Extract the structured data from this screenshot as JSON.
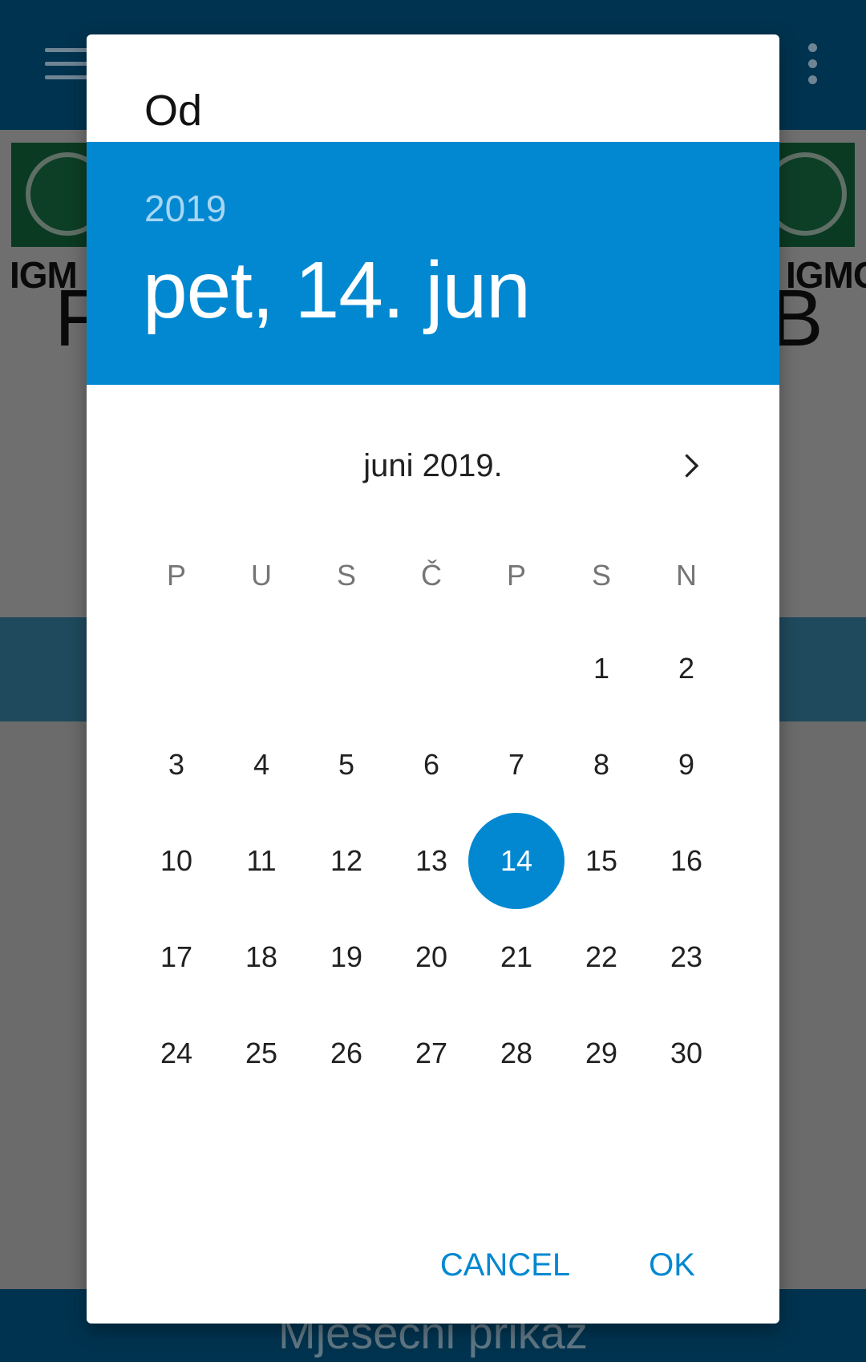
{
  "background": {
    "bottom_bar_text": "Mjesečni prikaz",
    "logo_text_left": "IGM",
    "logo_text_right": "IGMG",
    "big_letter_left": "F",
    "big_letter_right": "B"
  },
  "dialog": {
    "title": "Od",
    "header": {
      "year": "2019",
      "date": "pet, 14. jun"
    },
    "month_label": "juni 2019.",
    "weekdays": [
      "P",
      "U",
      "S",
      "Č",
      "P",
      "S",
      "N"
    ],
    "weeks": [
      [
        "",
        "",
        "",
        "",
        "",
        "1",
        "2"
      ],
      [
        "3",
        "4",
        "5",
        "6",
        "7",
        "8",
        "9"
      ],
      [
        "10",
        "11",
        "12",
        "13",
        "14",
        "15",
        "16"
      ],
      [
        "17",
        "18",
        "19",
        "20",
        "21",
        "22",
        "23"
      ],
      [
        "24",
        "25",
        "26",
        "27",
        "28",
        "29",
        "30"
      ]
    ],
    "selected_day": "14",
    "cancel_label": "CANCEL",
    "ok_label": "OK"
  },
  "colors": {
    "accent": "#0288d1",
    "app_bar": "#00334f",
    "scrim": "#6b6b6b"
  },
  "icons": {
    "menu": "hamburger-menu-icon",
    "more": "more-vertical-icon",
    "next": "chevron-right-icon"
  }
}
